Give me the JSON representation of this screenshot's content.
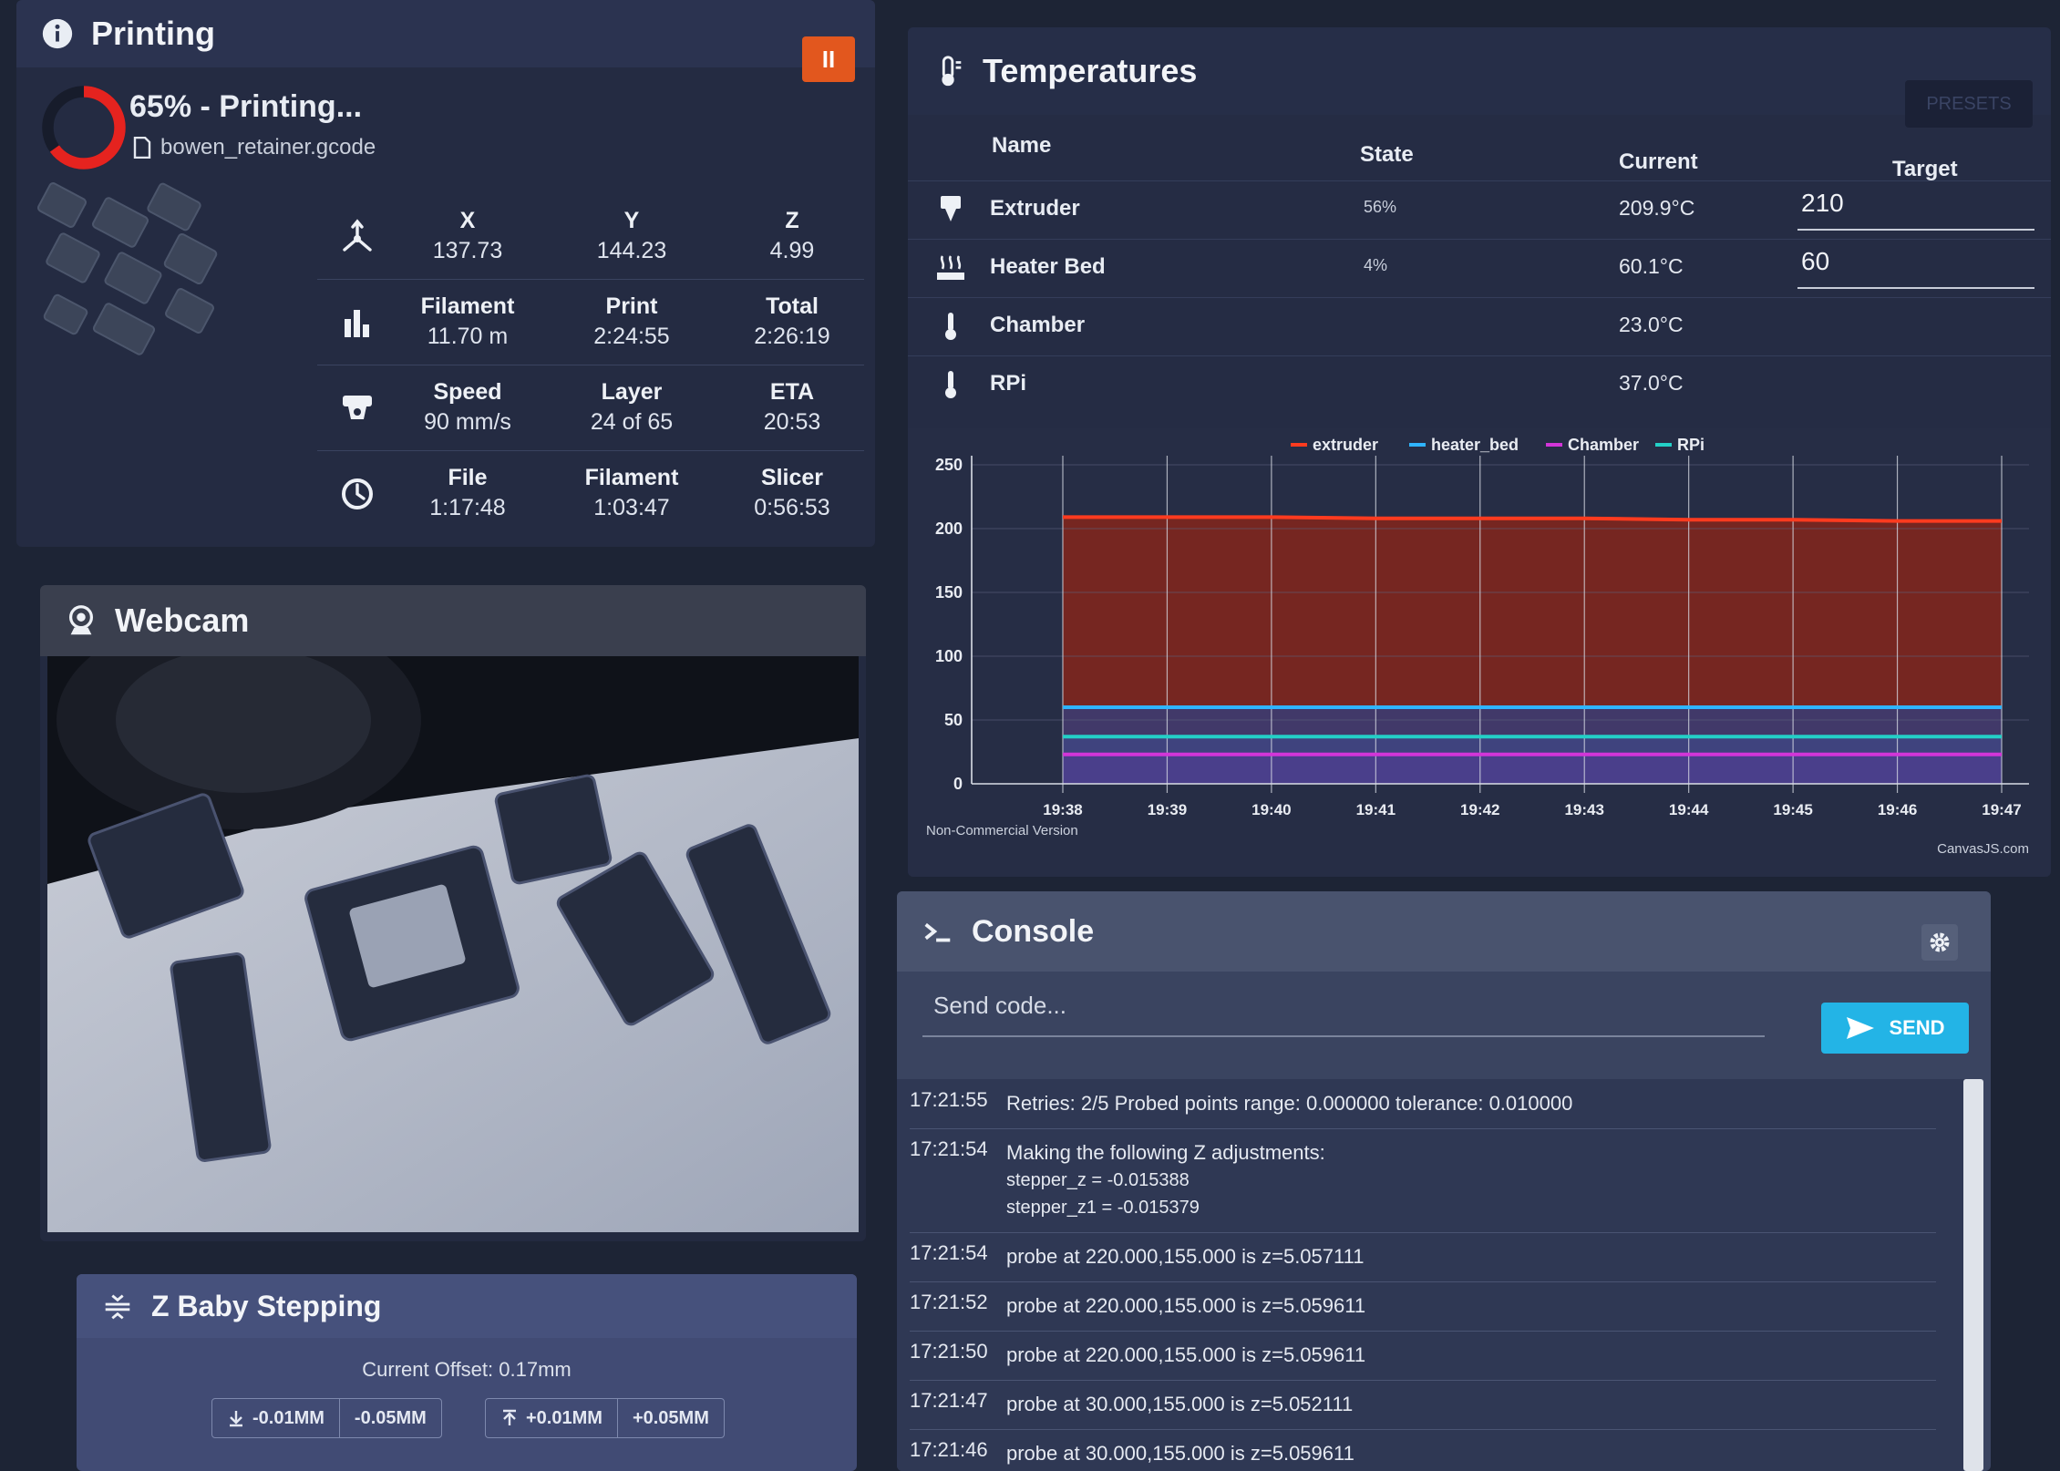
{
  "printing": {
    "title": "Printing",
    "status": "65% - Printing...",
    "progress_fraction": 0.65,
    "filename": "bowen_retainer.gcode",
    "position": {
      "x_label": "X",
      "x": "137.73",
      "y_label": "Y",
      "y": "144.23",
      "z_label": "Z",
      "z": "4.99"
    },
    "usage": {
      "filament_label": "Filament",
      "filament": "11.70 m",
      "print_label": "Print",
      "print": "2:24:55",
      "total_label": "Total",
      "total": "2:26:19"
    },
    "speed": {
      "speed_label": "Speed",
      "speed": "90 mm/s",
      "layer_label": "Layer",
      "layer": "24 of 65",
      "eta_label": "ETA",
      "eta": "20:53"
    },
    "estimates": {
      "file_label": "File",
      "file": "1:17:48",
      "filament_label": "Filament",
      "filament": "1:03:47",
      "slicer_label": "Slicer",
      "slicer": "0:56:53"
    }
  },
  "webcam": {
    "title": "Webcam"
  },
  "zbaby": {
    "title": "Z Baby Stepping",
    "current_offset": "Current Offset: 0.17mm",
    "down_small": "-0.01MM",
    "down_large": "-0.05MM",
    "up_small": "+0.01MM",
    "up_large": "+0.05MM"
  },
  "temperatures": {
    "title": "Temperatures",
    "presets_label": "PRESETS",
    "columns": {
      "name": "Name",
      "state": "State",
      "current": "Current",
      "target": "Target"
    },
    "rows": [
      {
        "name": "Extruder",
        "state": "56%",
        "current": "209.9°C",
        "target": "210"
      },
      {
        "name": "Heater Bed",
        "state": "4%",
        "current": "60.1°C",
        "target": "60"
      },
      {
        "name": "Chamber",
        "state": "",
        "current": "23.0°C",
        "target": ""
      },
      {
        "name": "RPi",
        "state": "",
        "current": "37.0°C",
        "target": ""
      }
    ]
  },
  "chart_data": {
    "type": "area",
    "x": [
      "19:38",
      "19:39",
      "19:40",
      "19:41",
      "19:42",
      "19:43",
      "19:44",
      "19:45",
      "19:46",
      "19:47"
    ],
    "series": [
      {
        "name": "extruder",
        "color": "#ff3b1f",
        "values": [
          209,
          209,
          209,
          208,
          208,
          208,
          207,
          207,
          206,
          206
        ]
      },
      {
        "name": "heater_bed",
        "color": "#2fb4ff",
        "values": [
          60,
          60,
          60,
          60,
          60,
          60,
          60,
          60,
          60,
          60
        ]
      },
      {
        "name": "Chamber",
        "color": "#d235d8",
        "values": [
          23,
          23,
          23,
          23,
          23,
          23,
          23,
          23,
          23,
          23
        ]
      },
      {
        "name": "RPi",
        "color": "#23d0c7",
        "values": [
          37,
          37,
          37,
          37,
          37,
          37,
          37,
          37,
          37,
          37
        ]
      }
    ],
    "yticks": [
      "0",
      "50",
      "100",
      "150",
      "200",
      "250"
    ],
    "ylim": [
      0,
      250
    ],
    "grid": true,
    "legend": "top-center",
    "footer_left": "Non-Commercial Version",
    "footer_right": "CanvasJS.com"
  },
  "console": {
    "title": "Console",
    "input_placeholder": "Send code...",
    "send_label": "SEND",
    "entries": [
      {
        "time": "17:21:55",
        "lines": [
          "Retries: 2/5 Probed points range: 0.000000 tolerance: 0.010000"
        ]
      },
      {
        "time": "17:21:54",
        "lines": [
          "Making the following Z adjustments:",
          "stepper_z = -0.015388",
          "stepper_z1 = -0.015379"
        ]
      },
      {
        "time": "17:21:54",
        "lines": [
          "probe at 220.000,155.000 is z=5.057111"
        ]
      },
      {
        "time": "17:21:52",
        "lines": [
          "probe at 220.000,155.000 is z=5.059611"
        ]
      },
      {
        "time": "17:21:50",
        "lines": [
          "probe at 220.000,155.000 is z=5.059611"
        ]
      },
      {
        "time": "17:21:47",
        "lines": [
          "probe at 30.000,155.000 is z=5.052111"
        ]
      },
      {
        "time": "17:21:46",
        "lines": [
          "probe at 30.000,155.000 is z=5.059611"
        ]
      }
    ]
  },
  "colors": {
    "accent": "#23b4e6",
    "pause": "#e2571e",
    "progress": "#e5231f"
  }
}
